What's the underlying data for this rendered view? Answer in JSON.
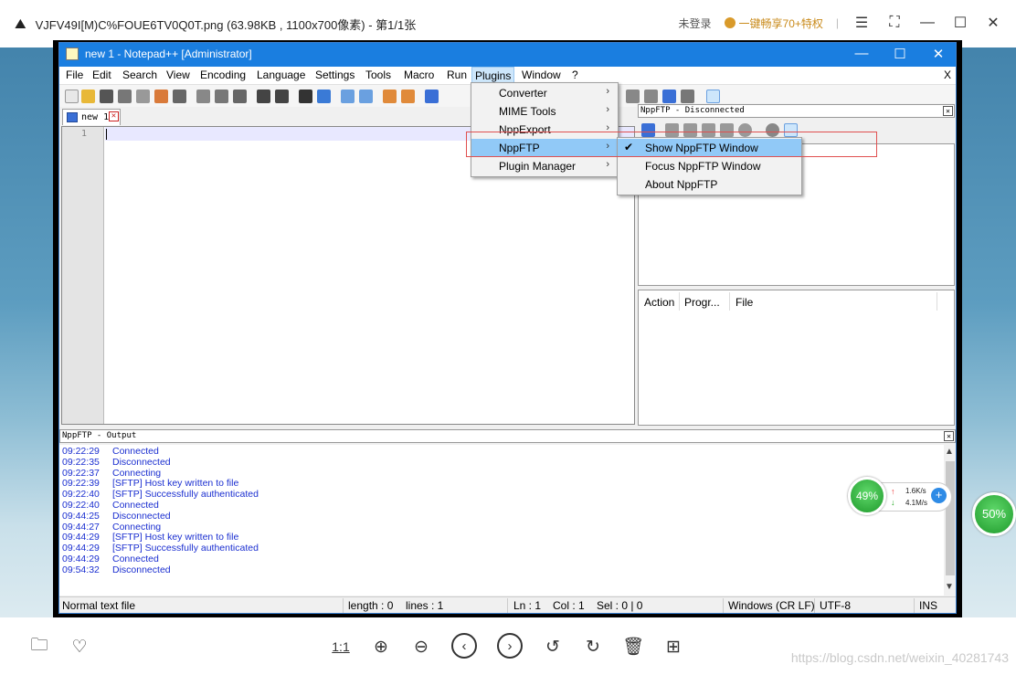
{
  "viewer": {
    "title": "VJFV49I[M)C%FOUE6TV0Q0T.png (63.98KB , 1100x700像素) - 第1/1张",
    "login": "未登录",
    "share": "一键畅享70+特权",
    "zoom_ratio": "1:1",
    "watermark": "https://blog.csdn.net/weixin_40281743"
  },
  "npp": {
    "title": "new 1 - Notepad++ [Administrator]",
    "menu": [
      "File",
      "Edit",
      "Search",
      "View",
      "Encoding",
      "Language",
      "Settings",
      "Tools",
      "Macro",
      "Run",
      "Plugins",
      "Window",
      "?"
    ],
    "menu_close": "X",
    "tab": "new 1",
    "line_number": "1"
  },
  "plugins_menu": [
    "Converter",
    "MIME Tools",
    "NppExport",
    "NppFTP",
    "Plugin Manager"
  ],
  "nppftp_submenu": [
    "Show NppFTP Window",
    "Focus NppFTP Window",
    "About NppFTP"
  ],
  "ftp_panel": {
    "title": "NppFTP - Disconnected",
    "columns": [
      "Action",
      "Progr...",
      "File"
    ]
  },
  "output": {
    "title": "NppFTP - Output",
    "lines": [
      {
        "time": "09:22:29",
        "msg": "Connected"
      },
      {
        "time": "09:22:35",
        "msg": "Disconnected"
      },
      {
        "time": "09:22:37",
        "msg": "Connecting"
      },
      {
        "time": "09:22:39",
        "msg": "[SFTP] Host key written to file"
      },
      {
        "time": "09:22:40",
        "msg": "[SFTP] Successfully authenticated"
      },
      {
        "time": "09:22:40",
        "msg": "Connected"
      },
      {
        "time": "09:44:25",
        "msg": "Disconnected"
      },
      {
        "time": "09:44:27",
        "msg": "Connecting"
      },
      {
        "time": "09:44:29",
        "msg": "[SFTP] Host key written to file"
      },
      {
        "time": "09:44:29",
        "msg": "[SFTP] Successfully authenticated"
      },
      {
        "time": "09:44:29",
        "msg": "Connected"
      },
      {
        "time": "09:54:32",
        "msg": "Disconnected"
      }
    ]
  },
  "status": {
    "type": "Normal text file",
    "length": "length : 0",
    "lines": "lines : 1",
    "ln": "Ln : 1",
    "col": "Col : 1",
    "sel": "Sel : 0 | 0",
    "eol": "Windows (CR LF)",
    "enc": "UTF-8",
    "ins": "INS"
  },
  "speed": {
    "cpu": "49%",
    "up": "1.6K/s",
    "down": "4.1M/s",
    "mem": "50%"
  },
  "colors": {
    "title_blue": "#1a7ee0",
    "menu_highlight": "#91c9f7",
    "log_text": "#1a2ed0",
    "annotation": "#e05050"
  }
}
